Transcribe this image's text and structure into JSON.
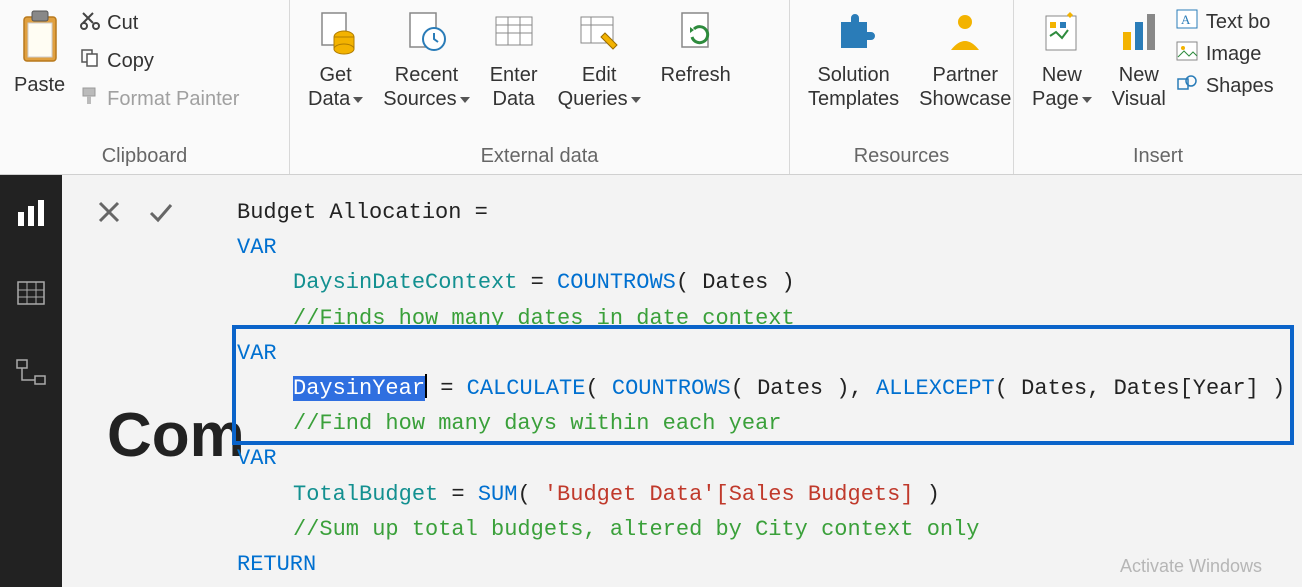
{
  "ribbon": {
    "clipboard": {
      "label": "Clipboard",
      "paste": "Paste",
      "cut": "Cut",
      "copy": "Copy",
      "format_painter": "Format Painter"
    },
    "external": {
      "label": "External data",
      "get_data": "Get\nData",
      "recent_sources": "Recent\nSources",
      "enter_data": "Enter\nData",
      "edit_queries": "Edit\nQueries",
      "refresh": "Refresh"
    },
    "resources": {
      "label": "Resources",
      "solution_templates": "Solution\nTemplates",
      "partner_showcase": "Partner\nShowcase"
    },
    "insert": {
      "label": "Insert",
      "new_page": "New\nPage",
      "new_visual": "New\nVisual",
      "text_box": "Text bo",
      "image": "Image",
      "shapes": "Shapes"
    }
  },
  "report": {
    "truncated_title": "Com"
  },
  "formula": {
    "line1_prefix": "Budget Allocation = ",
    "var": "VAR",
    "return": "RETURN",
    "v1_name": "DaysinDateContext",
    "countrows": "COUNTROWS",
    "dates": "Dates",
    "c1": "//Finds how many dates in date context",
    "v2_name": "DaysinYear",
    "calculate": "CALCULATE",
    "allexcept": "ALLEXCEPT",
    "dates_year": "Dates[Year]",
    "c2": "//Find how many days within each year",
    "v3_name": "TotalBudget",
    "sum": "SUM",
    "budget_col": "'Budget Data'[Sales Budgets]",
    "c3": "//Sum up total budgets, altered by City context only"
  },
  "watermark": "Activate Windows"
}
